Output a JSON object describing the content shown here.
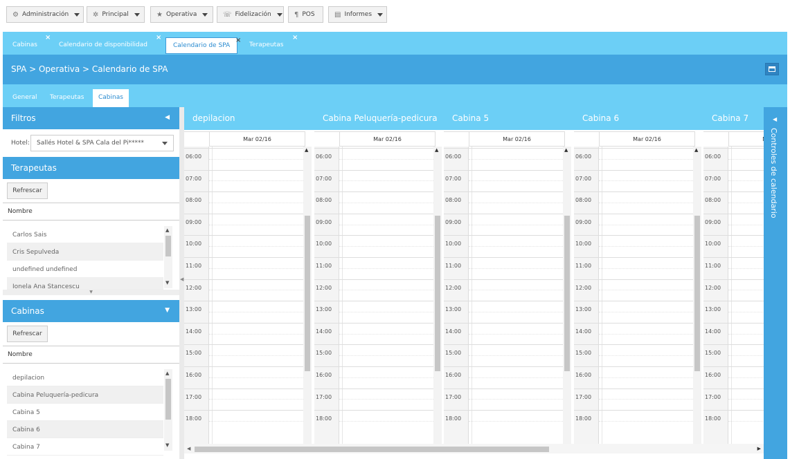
{
  "menu": [
    {
      "label": "Administración",
      "icon": "gear-icon",
      "glyph": "⚙",
      "caret": true
    },
    {
      "label": "Principal",
      "icon": "spinner-icon",
      "glyph": "✲",
      "caret": true
    },
    {
      "label": "Operativa",
      "icon": "star-icon",
      "glyph": "★",
      "caret": true
    },
    {
      "label": "Fidelización",
      "icon": "handshake-icon",
      "glyph": "☏",
      "caret": true
    },
    {
      "label": "POS",
      "icon": "cutlery-icon",
      "glyph": "¶",
      "caret": false
    },
    {
      "label": "Informes",
      "icon": "report-icon",
      "glyph": "▤",
      "caret": true
    }
  ],
  "tabs": [
    {
      "label": "Cabinas",
      "active": false
    },
    {
      "label": "Calendario de disponibilidad",
      "active": false
    },
    {
      "label": "Calendario de SPA",
      "active": true
    },
    {
      "label": "Terapeutas",
      "active": false
    }
  ],
  "tab_close_glyph": "×",
  "breadcrumb": "SPA > Operativa > Calendario de SPA",
  "subtabs": [
    {
      "label": "General",
      "active": false
    },
    {
      "label": "Terapeutas",
      "active": false
    },
    {
      "label": "Cabinas",
      "active": true
    }
  ],
  "filters": {
    "title": "Filtros",
    "hotel_label": "Hotel:",
    "hotel_value": "Sallés Hotel & SPA Cala del Pi*****"
  },
  "therapists": {
    "title": "Terapeutas",
    "refresh_label": "Refrescar",
    "column": "Nombre",
    "rows": [
      "Carlos Sais",
      "Cris Sepulveda",
      "undefined undefined",
      "Ionela Ana Stancescu"
    ]
  },
  "cabins_panel": {
    "title": "Cabinas",
    "refresh_label": "Refrescar",
    "column": "Nombre",
    "rows": [
      "depilacion",
      "Cabina Peluquería-pedicura",
      "Cabina 5",
      "Cabina 6",
      "Cabina 7"
    ]
  },
  "calendar": {
    "date_label": "Mar 02/16",
    "hours": [
      "06:00",
      "07:00",
      "08:00",
      "09:00",
      "10:00",
      "11:00",
      "12:00",
      "13:00",
      "14:00",
      "15:00",
      "16:00",
      "17:00",
      "18:00"
    ],
    "columns": [
      "depilacion",
      "Cabina Peluquería-pedicura",
      "Cabina 5",
      "Cabina 6",
      "Cabina 7"
    ]
  },
  "right_panel": {
    "label": "Controles de calendario"
  },
  "colors": {
    "accent": "#42a5e0",
    "light": "#6ccff6"
  }
}
